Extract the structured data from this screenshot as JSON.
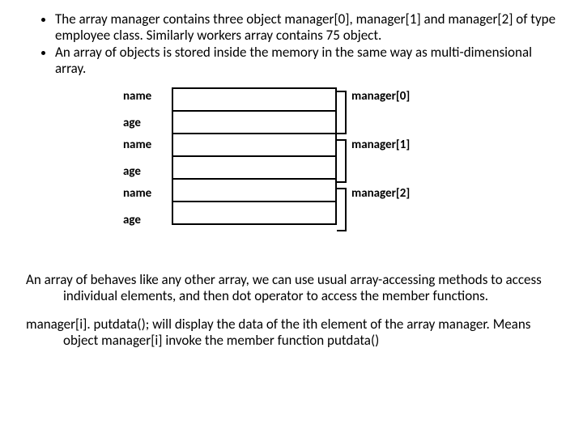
{
  "bullets": [
    "The array manager contains three object manager[0], manager[1] and manager[2] of type employee class. Similarly workers array contains 75 object.",
    "An array of objects is stored inside the memory in the same way as multi-dimensional array."
  ],
  "diagram": {
    "fields": [
      "name",
      "age",
      "name",
      "age",
      "name",
      "age"
    ],
    "indices": [
      "manager[0]",
      "manager[1]",
      "manager[2]"
    ]
  },
  "para1": "An array of behaves like any other array, we can use usual array-accessing methods to access individual elements, and then dot operator to access the member functions.",
  "para2": "manager[i]. putdata();  will display the data of the ith element of the array manager. Means object manager[i] invoke the member function putdata()"
}
